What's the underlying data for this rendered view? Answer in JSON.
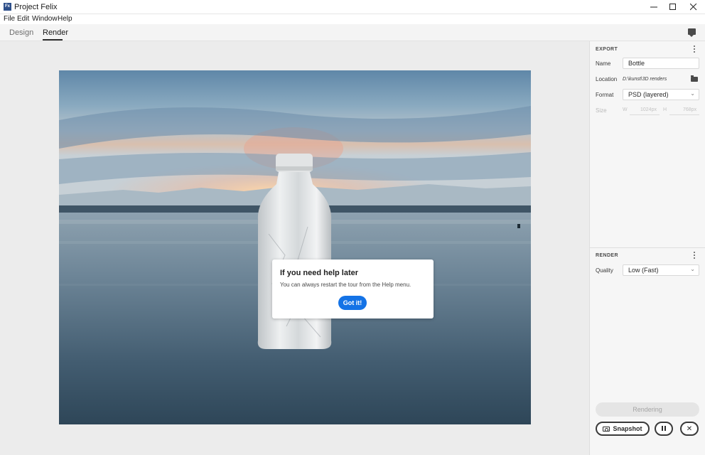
{
  "window": {
    "title": "Project Felix",
    "app_icon_text": "Fx",
    "minimize_icon": "minimize-icon",
    "maximize_icon": "maximize-icon",
    "close_icon": "close-icon"
  },
  "menu": {
    "items": [
      "File",
      "Edit",
      "Window",
      "Help"
    ]
  },
  "tabs": [
    {
      "label": "Design",
      "active": false
    },
    {
      "label": "Render",
      "active": true
    }
  ],
  "header_icons": {
    "comment": "comment-icon"
  },
  "tooltip": {
    "title": "If you need help later",
    "body": "You can always restart the tour from the Help menu.",
    "button": "Got it!"
  },
  "export": {
    "heading": "EXPORT",
    "name_label": "Name",
    "name_value": "Bottle",
    "location_label": "Location",
    "location_value": "D:\\kunst\\3D renders",
    "format_label": "Format",
    "format_value": "PSD (layered)",
    "size_label": "Size",
    "width_label": "W",
    "width_value": "1024px",
    "height_label": "H",
    "height_value": "768px"
  },
  "render": {
    "heading": "RENDER",
    "quality_label": "Quality",
    "quality_value": "Low (Fast)"
  },
  "actions": {
    "rendering_label": "Rendering",
    "snapshot_label": "Snapshot",
    "pause_icon": "pause-icon",
    "cancel_icon": "close-icon"
  },
  "colors": {
    "accent": "#1473e6",
    "canvas_bg": "#ececec",
    "sidebar_bg": "#f6f6f6"
  }
}
